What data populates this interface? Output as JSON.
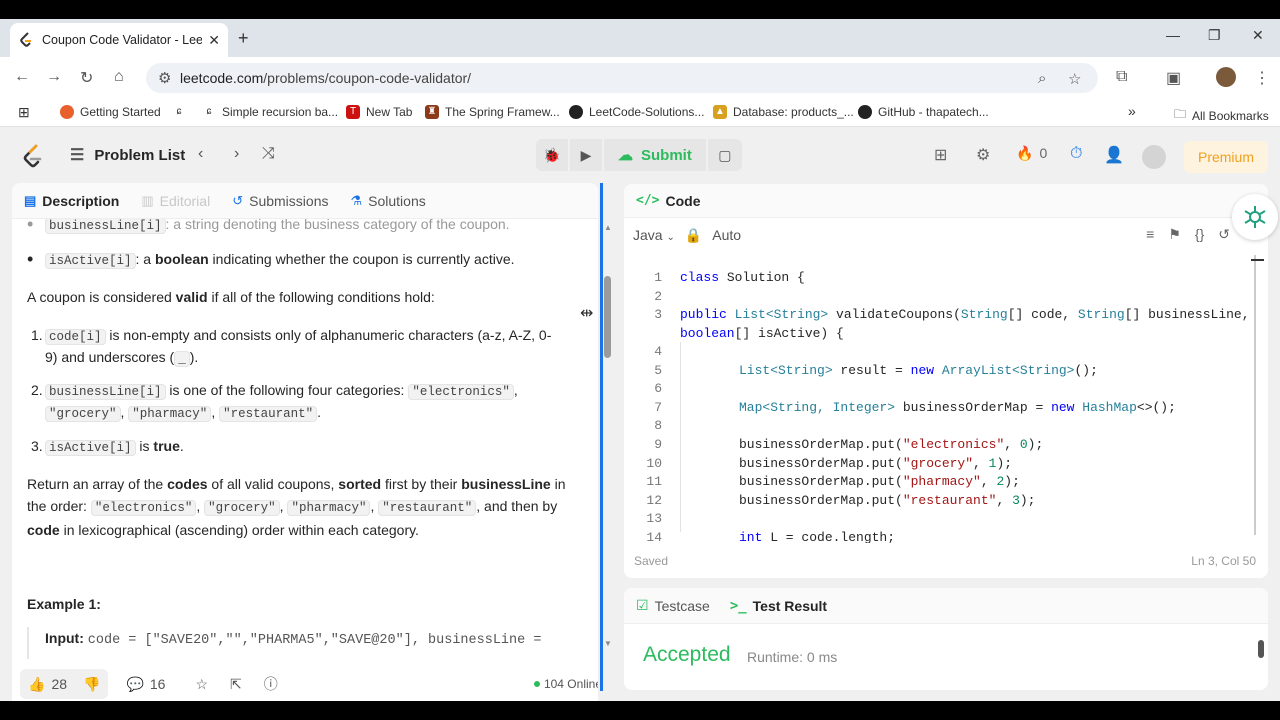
{
  "browser": {
    "tab_title": "Coupon Code Validator - LeetC",
    "url_host": "leetcode.com",
    "url_path": "/problems/coupon-code-validator/",
    "bookmarks": [
      {
        "label": "Getting Started"
      },
      {
        "label": "Simple recursion ba..."
      },
      {
        "label": "New Tab"
      },
      {
        "label": "The Spring Framew..."
      },
      {
        "label": "LeetCode-Solutions..."
      },
      {
        "label": "Database: products_..."
      },
      {
        "label": "GitHub - thapatech..."
      }
    ],
    "all_bookmarks": "All Bookmarks"
  },
  "header": {
    "problem_list": "Problem List",
    "submit": "Submit",
    "streak": "0",
    "premium": "Premium"
  },
  "left_tabs": {
    "description": "Description",
    "editorial": "Editorial",
    "submissions": "Submissions",
    "solutions": "Solutions"
  },
  "description": {
    "cut_line_code": "businessLine[i]",
    "cut_line_rest": ": a string denoting the business category of the coupon.",
    "isactive_code": "isActive[i]",
    "isactive_text1": ": a ",
    "isactive_bold": "boolean",
    "isactive_text2": " indicating whether the coupon is currently active.",
    "valid_intro1": "A coupon is considered ",
    "valid_intro_bold": "valid",
    "valid_intro2": " if all of the following conditions hold:",
    "c1_num": "1.",
    "c1_code": "code[i]",
    "c1_text": " is non-empty and consists only of alphanumeric characters (a-z, A-Z, 0-",
    "c1_text2": "9) and underscores (",
    "c1_code2": "_",
    "c1_text3": ").",
    "c2_num": "2.",
    "c2_code": "businessLine[i]",
    "c2_text": " is one of the following four categories: ",
    "cat1": "\"electronics\"",
    "cat2": "\"grocery\"",
    "cat3": "\"pharmacy\"",
    "cat4": "\"restaurant\"",
    "c3_num": "3.",
    "c3_code": "isActive[i]",
    "c3_text": " is ",
    "c3_bold": "true",
    "ret1": "Return an array of the ",
    "ret_codes": "codes",
    "ret2": " of all valid coupons, ",
    "ret_sorted": "sorted",
    "ret3": " first by their ",
    "ret_bl": "businessLine",
    "ret4": " in",
    "ret5": "the order: ",
    "ret6": ", and then by",
    "ret_code": "code",
    "ret7": " in lexicographical (ascending) order within each category.",
    "example_title": "Example 1:",
    "input_label": "Input:",
    "input_value": "code = [\"SAVE20\",\"\",\"PHARMA5\",\"SAVE@20\"], businessLine ="
  },
  "footer": {
    "likes": "28",
    "comments": "16",
    "online": "104 Online"
  },
  "code_panel": {
    "title": "Code",
    "language": "Java",
    "mode": "Auto",
    "status_left": "Saved",
    "status_right": "Ln 3, Col 50"
  },
  "code_lines": [
    {
      "n": "1"
    },
    {
      "n": "2"
    },
    {
      "n": "3"
    },
    {
      "n": ""
    },
    {
      "n": "4"
    },
    {
      "n": "5"
    },
    {
      "n": "6"
    },
    {
      "n": "7"
    },
    {
      "n": "8"
    },
    {
      "n": "9"
    },
    {
      "n": "10"
    },
    {
      "n": "11"
    },
    {
      "n": "12"
    },
    {
      "n": "13"
    },
    {
      "n": "14"
    }
  ],
  "code": {
    "l1_kw": "class",
    "l1_rest": " Solution {",
    "l3_a": "public",
    "l3_b": " List",
    "l3_c": "<String>",
    "l3_d": " validateCoupons(",
    "l3_e": "String",
    "l3_f": "[] code, ",
    "l3_g": "String",
    "l3_h": "[] businessLine,",
    "l3w_a": "boolean",
    "l3w_b": "[] isActive) {",
    "l5_a": "List<String>",
    "l5_b": " result = ",
    "l5_c": "new",
    "l5_d": " ArrayList<String>",
    "l5_e": "();",
    "l7_a": "Map<String, Integer>",
    "l7_b": " businessOrderMap = ",
    "l7_c": "new",
    "l7_d": " HashMap",
    "l7_e": "<>();",
    "put": "businessOrderMap.put(",
    "p1s": "\"electronics\"",
    "p1n": "0",
    "p2s": "\"grocery\"",
    "p2n": "1",
    "p3s": "\"pharmacy\"",
    "p3n": "2",
    "p4s": "\"restaurant\"",
    "p4n": "3",
    "end": ");",
    "l14_a": "int",
    "l14_b": " L = code.length;"
  },
  "result": {
    "testcase": "Testcase",
    "test_result": "Test Result",
    "status": "Accepted",
    "runtime": "Runtime: 0 ms"
  }
}
